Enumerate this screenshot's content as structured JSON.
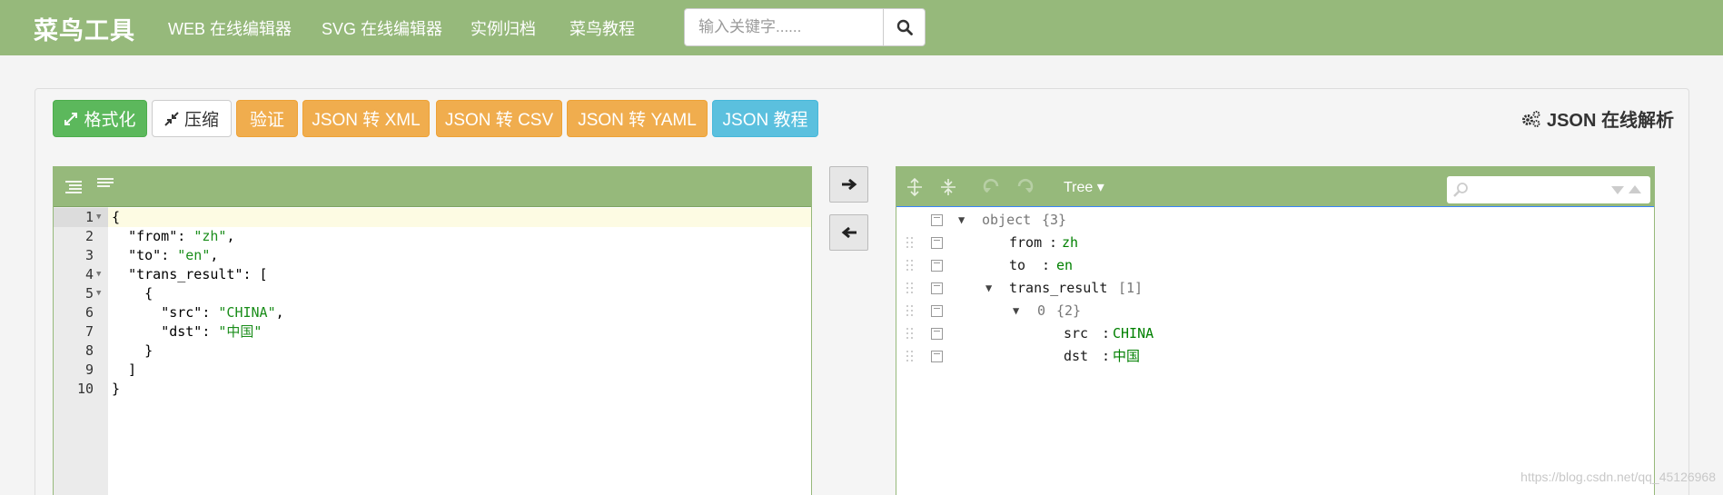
{
  "nav": {
    "brand": "菜鸟工具",
    "links": [
      "WEB 在线编辑器",
      "SVG 在线编辑器",
      "实例归档",
      "菜鸟教程"
    ],
    "search_placeholder": "输入关键字......"
  },
  "toolbar": {
    "format_label": "格式化",
    "compress_label": "压缩",
    "validate_label": "验证",
    "to_xml_label": "JSON 转 XML",
    "to_csv_label": "JSON 转 CSV",
    "to_yaml_label": "JSON 转 YAML",
    "tutorial_label": "JSON 教程",
    "title": "JSON 在线解析"
  },
  "editor": {
    "line_numbers": [
      "1",
      "2",
      "3",
      "4",
      "5",
      "6",
      "7",
      "8",
      "9",
      "10"
    ],
    "lines": [
      "{",
      "  \"from\": \"zh\",",
      "  \"to\": \"en\",",
      "  \"trans_result\": [",
      "    {",
      "      \"src\": \"CHINA\",",
      "      \"dst\": \"中国\"",
      "    }",
      "  ]",
      "}"
    ]
  },
  "tree": {
    "mode": "Tree ▾",
    "root_label": "object",
    "root_count": "{3}",
    "rows": [
      {
        "key": "from",
        "sep": ":",
        "value": "zh"
      },
      {
        "key": "to",
        "sep": ":",
        "value": "en"
      },
      {
        "key": "trans_result",
        "meta": "[1]"
      },
      {
        "key": "0",
        "meta": "{2}"
      },
      {
        "key": "src",
        "sep": ":",
        "value": "CHINA"
      },
      {
        "key": "dst",
        "sep": ":",
        "value": "中国"
      }
    ]
  },
  "watermark": "https://blog.csdn.net/qq_45126968",
  "colors": {
    "nav_green": "#96b97b",
    "success": "#5cb85c",
    "warning": "#f0ad4e",
    "info": "#5bc0de",
    "string_green": "#1a8d1a"
  }
}
